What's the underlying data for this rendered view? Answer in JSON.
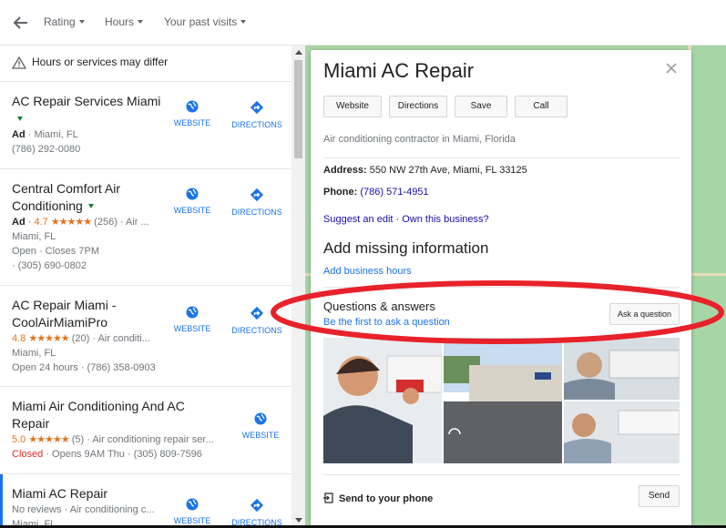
{
  "filters": [
    "Rating",
    "Hours",
    "Your past visits"
  ],
  "notice": "Hours or services may differ",
  "results": [
    {
      "title": "AC Repair Services Miami",
      "line1_ad": "Ad",
      "line1": " · Miami, FL",
      "line2": "(786) 292-0080",
      "actions": [
        "WEBSITE",
        "DIRECTIONS"
      ]
    },
    {
      "title": "Central Comfort Air Conditioning",
      "line1_ad": "Ad",
      "rating": "4.7",
      "stars": "★★★★★",
      "line1": " (256) · Air ...",
      "line2": "Miami, FL",
      "line3": "Open · Closes 7PM",
      "line4": "· (305) 690-0802",
      "actions": [
        "WEBSITE",
        "DIRECTIONS"
      ]
    },
    {
      "title": "AC Repair Miami - CoolAirMiamiPro",
      "rating": "4.8",
      "stars": "★★★★★",
      "line1": " (20) · Air conditi...",
      "line2": "Miami, FL",
      "line3": "Open 24 hours · (786) 358-0903",
      "actions": [
        "WEBSITE",
        "DIRECTIONS"
      ]
    },
    {
      "title": "Miami Air Conditioning And AC Repair",
      "rating": "5.0",
      "stars": "★★★★★",
      "line1": " (5) · Air conditioning repair ser...",
      "line2": "Miami, FL",
      "closed": "Closed",
      "line3": " · Opens 9AM Thu · (305) 809-7596",
      "actions": [
        "WEBSITE"
      ]
    },
    {
      "title": "Miami AC Repair",
      "line1": "No reviews · Air conditioning c...",
      "line2": "Miami, FL",
      "actions": [
        "WEBSITE",
        "DIRECTIONS"
      ]
    }
  ],
  "detail": {
    "name": "Miami AC Repair",
    "buttons": [
      "Website",
      "Directions",
      "Save",
      "Call"
    ],
    "category": "Air conditioning contractor in Miami, Florida",
    "address_label": "Address:",
    "address": "550 NW 27th Ave, Miami, FL 33125",
    "phone_label": "Phone:",
    "phone": "(786) 571-4951",
    "suggest_edit": "Suggest an edit",
    "sep": "·",
    "own_business": "Own this business?",
    "missing_title": "Add missing information",
    "add_hours": "Add business hours",
    "qa_title": "Questions & answers",
    "qa_link": "Be the first to ask a question",
    "ask_button": "Ask a question",
    "send_label": "Send to your phone",
    "send_button": "Send"
  },
  "colors": {
    "accent": "#1a73e8",
    "star": "#e7711b",
    "closed": "#d93025",
    "annotation": "#e8222a"
  }
}
